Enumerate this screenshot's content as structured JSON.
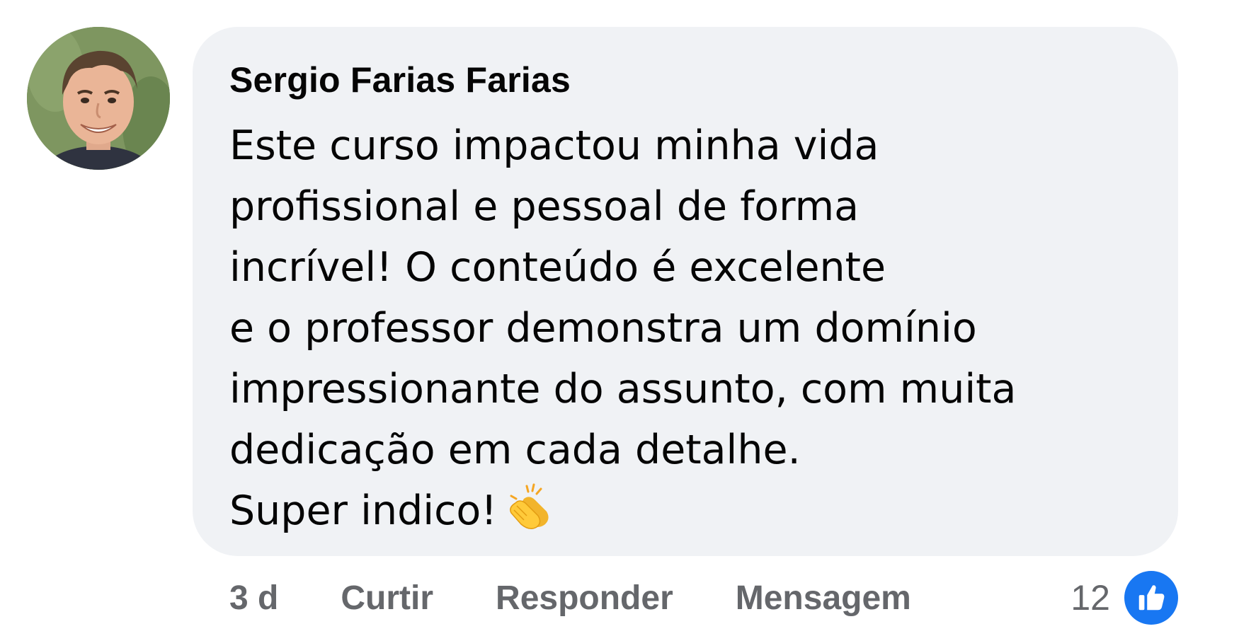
{
  "comment": {
    "author": "Sergio Farias Farias",
    "text_lines": [
      "Este curso impactou minha vida",
      "profissional e pessoal de forma",
      "incrível! O conteúdo é excelente",
      "e o professor demonstra um domínio",
      "impressionante do assunto, com muita",
      "dedicação em cada detalhe.",
      "Super indico!"
    ],
    "emoji_icon": "clapping-hands-icon",
    "avatar_icon": "user-avatar"
  },
  "actions": {
    "timestamp": "3 d",
    "like_label": "Curtir",
    "reply_label": "Responder",
    "message_label": "Mensagem"
  },
  "reactions": {
    "count": "12",
    "icon": "thumbs-up-icon"
  },
  "colors": {
    "bubble_background": "#f0f2f5",
    "primary_text": "#050505",
    "secondary_text": "#65676b",
    "like_blue": "#1877f2"
  }
}
